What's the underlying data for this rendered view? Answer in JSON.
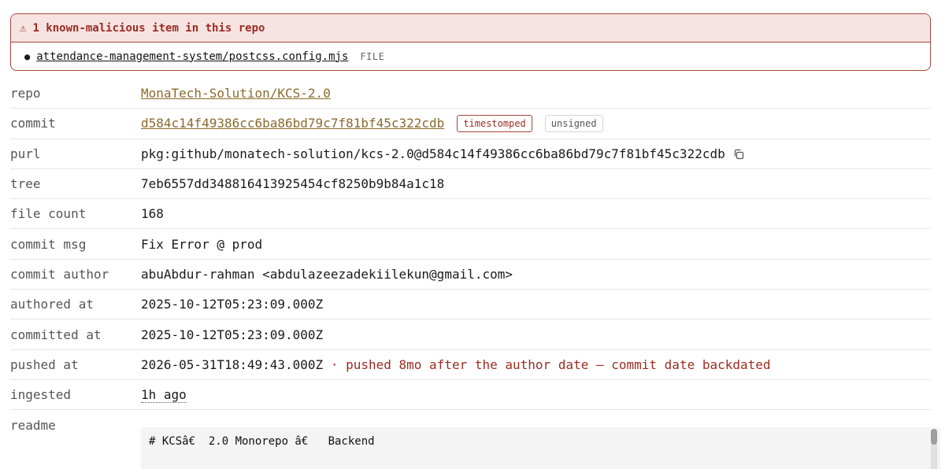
{
  "alert": {
    "icon": "warning-icon",
    "title": "1 known-malicious item in this repo",
    "items": [
      {
        "path": "attendance-management-system/postcss.config.mjs",
        "kind": "FILE"
      }
    ]
  },
  "details": {
    "repo": {
      "label": "repo",
      "value": "MonaTech-Solution/KCS-2.0"
    },
    "commit": {
      "label": "commit",
      "value": "d584c14f49386cc6ba86bd79c7f81bf45c322cdb",
      "badges": [
        "timestomped",
        "unsigned"
      ]
    },
    "purl": {
      "label": "purl",
      "value": "pkg:github/monatech-solution/kcs-2.0@d584c14f49386cc6ba86bd79c7f81bf45c322cdb",
      "icon": "copy-icon"
    },
    "tree": {
      "label": "tree",
      "value": "7eb6557dd348816413925454cf8250b9b84a1c18"
    },
    "file_count": {
      "label": "file count",
      "value": "168"
    },
    "commit_msg": {
      "label": "commit msg",
      "value": "Fix Error @ prod"
    },
    "commit_author": {
      "label": "commit author",
      "value": "abuAbdur-rahman <abdulazeezadekiilekun@gmail.com>"
    },
    "authored_at": {
      "label": "authored at",
      "value": "2025-10-12T05:23:09.000Z"
    },
    "committed_at": {
      "label": "committed at",
      "value": "2025-10-12T05:23:09.000Z"
    },
    "pushed_at": {
      "label": "pushed at",
      "value": "2026-05-31T18:49:43.000Z",
      "note": "· pushed 8mo after the author date — commit date backdated"
    },
    "ingested": {
      "label": "ingested",
      "value": "1h ago"
    },
    "readme": {
      "label": "readme",
      "value": "# KCSâ€  2.0 Monorepo â€   Backend"
    }
  },
  "colors": {
    "danger": "#9b2c22",
    "danger_bg": "#f7e4e2",
    "link": "#8a6a2c"
  }
}
